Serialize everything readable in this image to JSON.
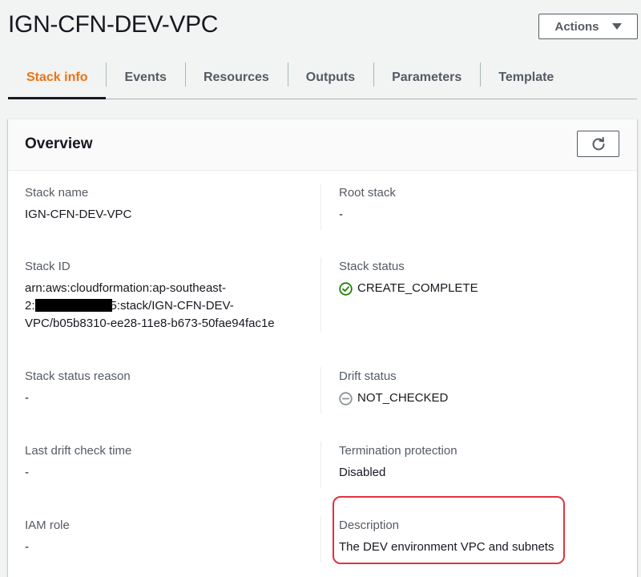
{
  "header": {
    "title": "IGN-CFN-DEV-VPC",
    "actions_label": "Actions"
  },
  "tabs": [
    {
      "label": "Stack info",
      "active": true
    },
    {
      "label": "Events"
    },
    {
      "label": "Resources"
    },
    {
      "label": "Outputs"
    },
    {
      "label": "Parameters"
    },
    {
      "label": "Template"
    }
  ],
  "overview": {
    "title": "Overview",
    "stack_name": {
      "label": "Stack name",
      "value": "IGN-CFN-DEV-VPC"
    },
    "root_stack": {
      "label": "Root stack",
      "value": "-"
    },
    "stack_id": {
      "label": "Stack ID",
      "line1": "arn:aws:cloudformation:ap-southeast-",
      "line2_prefix": "2:",
      "line2_suffix": "5:stack/IGN-CFN-DEV-",
      "line3": "VPC/b05b8310-ee28-11e8-b673-50fae94fac1e"
    },
    "stack_status": {
      "label": "Stack status",
      "value": "CREATE_COMPLETE",
      "color": "#1d8102"
    },
    "stack_status_reason": {
      "label": "Stack status reason",
      "value": "-"
    },
    "drift_status": {
      "label": "Drift status",
      "value": "NOT_CHECKED",
      "color": "#687078"
    },
    "last_drift_check": {
      "label": "Last drift check time",
      "value": "-"
    },
    "termination_protection": {
      "label": "Termination protection",
      "value": "Disabled"
    },
    "iam_role": {
      "label": "IAM role",
      "value": "-"
    },
    "description": {
      "label": "Description",
      "value": "The DEV environment VPC and subnets"
    }
  },
  "colors": {
    "accent": "#ec7211",
    "highlight": "#e0333d"
  }
}
